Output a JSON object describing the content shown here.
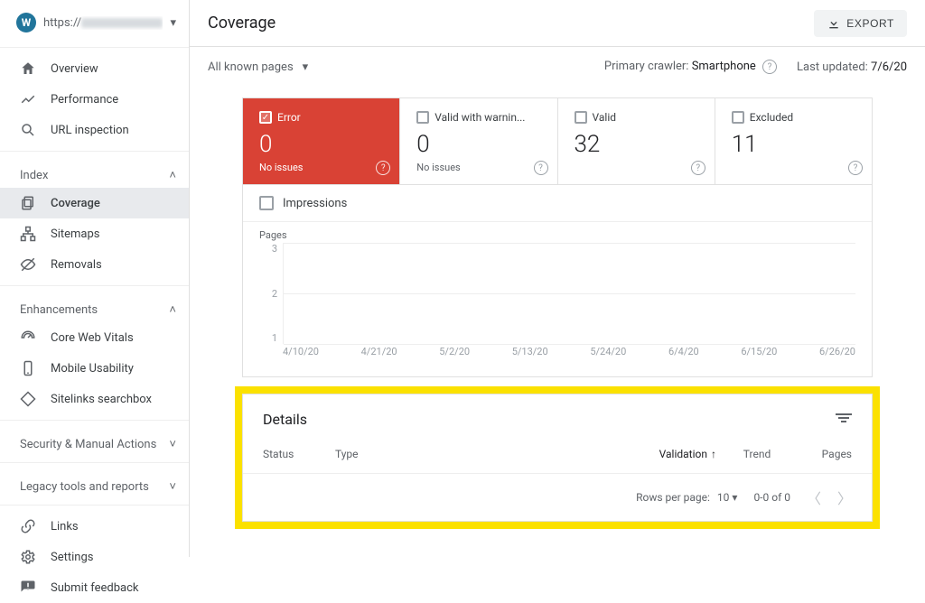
{
  "site": {
    "prefix": "https://"
  },
  "nav": {
    "overview": "Overview",
    "performance": "Performance",
    "url_inspection": "URL inspection",
    "index_header": "Index",
    "coverage": "Coverage",
    "sitemaps": "Sitemaps",
    "removals": "Removals",
    "enhancements_header": "Enhancements",
    "core_web_vitals": "Core Web Vitals",
    "mobile_usability": "Mobile Usability",
    "sitelinks_searchbox": "Sitelinks searchbox",
    "security_header": "Security & Manual Actions",
    "legacy_header": "Legacy tools and reports",
    "links": "Links",
    "settings": "Settings",
    "submit_feedback": "Submit feedback"
  },
  "header": {
    "title": "Coverage",
    "export": "EXPORT"
  },
  "filters": {
    "dropdown": "All known pages",
    "primary_crawler_label": "Primary crawler:",
    "primary_crawler_value": "Smartphone",
    "last_updated_label": "Last updated:",
    "last_updated_value": "7/6/20"
  },
  "status_cards": {
    "error": {
      "label": "Error",
      "value": "0",
      "sub": "No issues"
    },
    "warning": {
      "label": "Valid with warnin...",
      "value": "0",
      "sub": "No issues"
    },
    "valid": {
      "label": "Valid",
      "value": "32",
      "sub": ""
    },
    "excluded": {
      "label": "Excluded",
      "value": "11",
      "sub": ""
    }
  },
  "impressions_label": "Impressions",
  "details": {
    "title": "Details",
    "columns": {
      "status": "Status",
      "type": "Type",
      "validation": "Validation",
      "trend": "Trend",
      "pages": "Pages"
    },
    "footer": {
      "rows_per_page_label": "Rows per page:",
      "rows_per_page_value": "10",
      "range": "0-0 of 0"
    }
  },
  "chart_data": {
    "type": "line",
    "title": "",
    "ylabel": "Pages",
    "ylim": [
      0,
      3
    ],
    "yticks": [
      3,
      2,
      1
    ],
    "categories": [
      "4/10/20",
      "4/21/20",
      "5/2/20",
      "5/13/20",
      "5/24/20",
      "6/4/20",
      "6/15/20",
      "6/26/20"
    ],
    "series": [
      {
        "name": "Error",
        "values": [
          0,
          0,
          0,
          0,
          0,
          0,
          0,
          0
        ]
      }
    ]
  }
}
